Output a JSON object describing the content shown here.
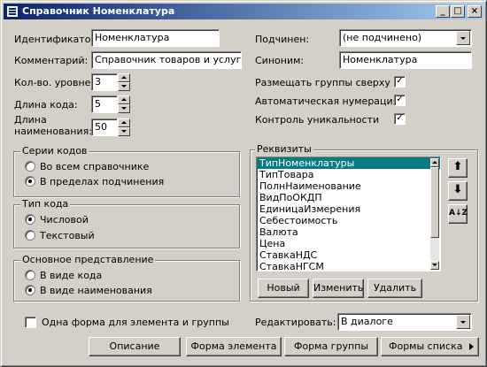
{
  "window": {
    "title": "Справочник Номенклатура",
    "minimize": "_",
    "maximize": "□",
    "close": "×"
  },
  "left": {
    "id_label": "Идентификатор:",
    "id_value": "Номенклатура",
    "comment_label": "Комментарий:",
    "comment_value": "Справочник товаров и услуг",
    "levels_label": "Кол-во. уровней:",
    "levels_value": "3",
    "code_len_label": "Длина кода:",
    "code_len_value": "5",
    "name_len_label1": "Длина",
    "name_len_label2": "наименования:",
    "name_len_value": "50"
  },
  "right": {
    "parent_label": "Подчинен:",
    "parent_value": "(не подчинено)",
    "synonym_label": "Синоним:",
    "synonym_value": "Номенклатура",
    "groups_top_label": "Размещать группы сверху",
    "auto_num_label": "Автоматическая нумерация",
    "unique_label": "Контроль уникальности",
    "check_mark": "✓"
  },
  "code_series": {
    "title": "Серии кодов",
    "opt1": "Во всем справочнике",
    "opt2": "В пределах подчинения"
  },
  "code_type": {
    "title": "Тип кода",
    "opt1": "Числовой",
    "opt2": "Текстовый"
  },
  "main_repr": {
    "title": "Основное представление",
    "opt1": "В виде кода",
    "opt2": "В виде наименования"
  },
  "requisites": {
    "title": "Реквизиты",
    "items": [
      "ТипНоменклатуры",
      "ТипТовара",
      "ПолнНаименование",
      "ВидПоОКДП",
      "ЕдиницаИзмерения",
      "Себестоимость",
      "Валюта",
      "Цена",
      "СтавкаНДС",
      "СтавкаНГСМ"
    ],
    "btn_new": "Новый",
    "btn_edit": "Изменить",
    "btn_delete": "Удалить",
    "move_up": "⬆",
    "move_down": "⬇",
    "sort": "A↓Z"
  },
  "bottom": {
    "one_form_label": "Одна форма для элемента и группы",
    "edit_label": "Редактировать:",
    "edit_value": "В диалоге",
    "btn_description": "Описание",
    "btn_element_form": "Форма элемента",
    "btn_group_form": "Форма группы",
    "btn_list_forms": "Формы списка"
  }
}
